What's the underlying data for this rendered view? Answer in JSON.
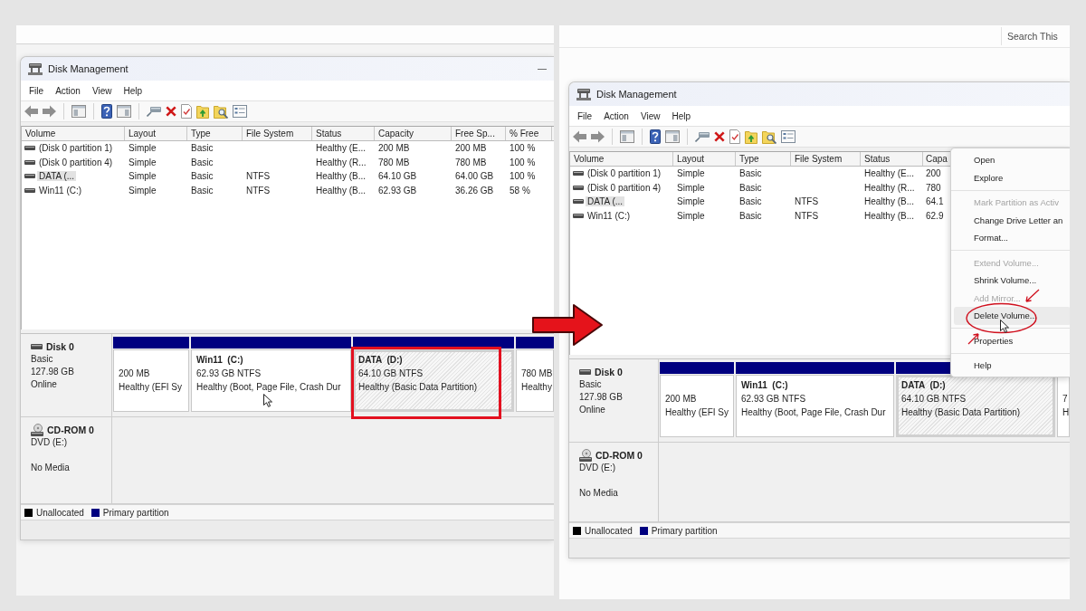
{
  "screenshots": [
    {
      "window": {
        "title": "Disk Management",
        "minimize_button": "—",
        "menu": [
          "File",
          "Action",
          "View",
          "Help"
        ],
        "volume_table": {
          "columns": [
            "Volume",
            "Layout",
            "Type",
            "File System",
            "Status",
            "Capacity",
            "Free Sp...",
            "% Free"
          ],
          "rows": [
            {
              "cells": [
                "(Disk 0 partition 1)",
                "Simple",
                "Basic",
                null,
                "Healthy (E...",
                "200 MB",
                "200 MB",
                "100 %"
              ],
              "selected": false
            },
            {
              "cells": [
                "(Disk 0 partition 4)",
                "Simple",
                "Basic",
                null,
                "Healthy (R...",
                "780 MB",
                "780 MB",
                "100 %"
              ],
              "selected": false
            },
            {
              "cells": [
                "DATA (...",
                "Simple",
                "Basic",
                "NTFS",
                "Healthy (B...",
                "64.10 GB",
                "64.00 GB",
                "100 %"
              ],
              "selected": true
            },
            {
              "cells": [
                "Win11 (C:)",
                "Simple",
                "Basic",
                "NTFS",
                "Healthy (B...",
                "62.93 GB",
                "36.26 GB",
                "58 %"
              ],
              "selected": false
            }
          ]
        },
        "disks": [
          {
            "kind": "disk",
            "name": "Disk 0",
            "type": "Basic",
            "size": "127.98 GB",
            "status": "Online",
            "partitions": [
              {
                "capacity": "200 MB",
                "status": "Healthy (EFI Sy",
                "selected": false,
                "highlighted": false,
                "hovered": false
              },
              {
                "name": "Win11  (C:)",
                "capacity": "62.93 GB NTFS",
                "status": "Healthy (Boot, Page File, Crash Dur",
                "selected": false,
                "highlighted": false,
                "hovered": true
              },
              {
                "name": "DATA  (D:)",
                "capacity": "64.10 GB NTFS",
                "status": "Healthy (Basic Data Partition)",
                "selected": true,
                "highlighted": true,
                "hovered": false
              },
              {
                "capacity": "780 MB",
                "status": "Healthy",
                "selected": false,
                "highlighted": false,
                "hovered": false
              }
            ]
          },
          {
            "kind": "cdrom",
            "name": "CD-ROM 0",
            "type": "DVD (E:)",
            "status": "No Media"
          }
        ],
        "legend": [
          {
            "label": "Unallocated",
            "color": "#000000"
          },
          {
            "label": "Primary partition",
            "color": "#000080"
          }
        ]
      }
    },
    {
      "search_field": {
        "placeholder": "Search This"
      },
      "window": {
        "title": "Disk Management",
        "menu": [
          "File",
          "Action",
          "View",
          "Help"
        ],
        "volume_table": {
          "columns": [
            "Volume",
            "Layout",
            "Type",
            "File System",
            "Status",
            "Capa"
          ],
          "rows": [
            {
              "cells": [
                "(Disk 0 partition 1)",
                "Simple",
                "Basic",
                null,
                "Healthy (E...",
                "200"
              ],
              "selected": false
            },
            {
              "cells": [
                "(Disk 0 partition 4)",
                "Simple",
                "Basic",
                null,
                "Healthy (R...",
                "780"
              ],
              "selected": false
            },
            {
              "cells": [
                "DATA (...",
                "Simple",
                "Basic",
                "NTFS",
                "Healthy (B...",
                "64.1"
              ],
              "selected": true
            },
            {
              "cells": [
                "Win11 (C:)",
                "Simple",
                "Basic",
                "NTFS",
                "Healthy (B...",
                "62.9"
              ],
              "selected": false
            }
          ]
        },
        "disks": [
          {
            "kind": "disk",
            "name": "Disk 0",
            "type": "Basic",
            "size": "127.98 GB",
            "status": "Online",
            "partitions": [
              {
                "capacity": "200 MB",
                "status": "Healthy (EFI Sy",
                "selected": false,
                "highlighted": false,
                "hovered": false
              },
              {
                "name": "Win11  (C:)",
                "capacity": "62.93 GB NTFS",
                "status": "Healthy (Boot, Page File, Crash Dur",
                "selected": false,
                "highlighted": false,
                "hovered": false
              },
              {
                "name": "DATA  (D:)",
                "capacity": "64.10 GB NTFS",
                "status": "Healthy (Basic Data Partition)",
                "selected": true,
                "highlighted": false,
                "hovered": false
              },
              {
                "capacity": "7",
                "status": "H",
                "selected": false,
                "highlighted": false,
                "hovered": false
              }
            ]
          },
          {
            "kind": "cdrom",
            "name": "CD-ROM 0",
            "type": "DVD (E:)",
            "status": "No Media"
          }
        ],
        "legend": [
          {
            "label": "Unallocated",
            "color": "#000000"
          },
          {
            "label": "Primary partition",
            "color": "#000080"
          }
        ],
        "context_menu": {
          "groups": [
            [
              {
                "label": "Open",
                "disabled": false,
                "selected": false,
                "circled": false
              },
              {
                "label": "Explore",
                "disabled": false,
                "selected": false,
                "circled": false
              }
            ],
            [
              {
                "label": "Mark Partition as Activ",
                "disabled": true,
                "selected": false,
                "circled": false
              },
              {
                "label": "Change Drive Letter an",
                "disabled": false,
                "selected": false,
                "circled": false
              },
              {
                "label": "Format...",
                "disabled": false,
                "selected": false,
                "circled": false
              }
            ],
            [
              {
                "label": "Extend Volume...",
                "disabled": true,
                "selected": false,
                "circled": false
              },
              {
                "label": "Shrink Volume...",
                "disabled": false,
                "selected": false,
                "circled": false
              },
              {
                "label": "Add Mirror...",
                "disabled": true,
                "selected": false,
                "circled": false
              },
              {
                "label": "Delete Volume...",
                "disabled": false,
                "selected": true,
                "circled": true
              }
            ],
            [
              {
                "label": "Properties",
                "disabled": false,
                "selected": false,
                "circled": false
              }
            ],
            [
              {
                "label": "Help",
                "disabled": false,
                "selected": false,
                "circled": false
              }
            ]
          ]
        }
      }
    }
  ]
}
